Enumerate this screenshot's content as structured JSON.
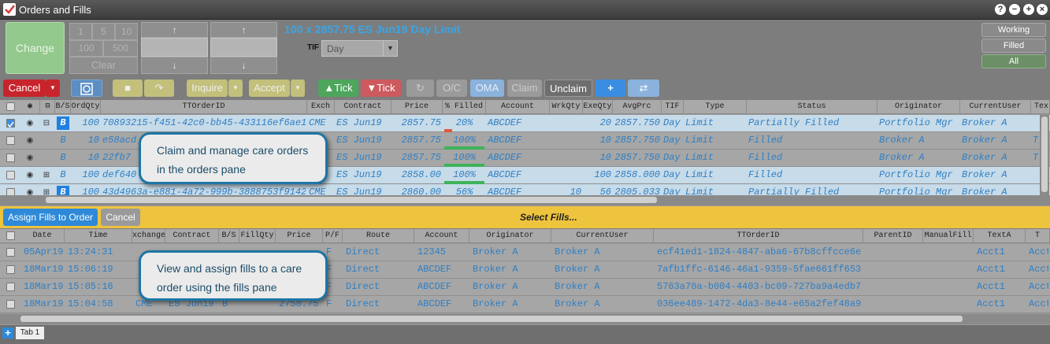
{
  "window": {
    "title": "Orders and Fills",
    "controls": [
      "?",
      "−",
      "+",
      "×"
    ]
  },
  "entry": {
    "change_label": "Change",
    "qty_buttons": [
      "1",
      "5",
      "10",
      "100",
      "500"
    ],
    "clear_label": "Clear",
    "order_desc": "100 x 2857.75 ES Jun19 Day Limit",
    "tif_label": "TIF",
    "tif_value": "Day"
  },
  "filters": {
    "working": "Working",
    "filled": "Filled",
    "all": "All"
  },
  "toolbar": {
    "cancel": "Cancel",
    "inquire": "Inquire",
    "accept": "Accept",
    "tick_up": "Tick",
    "tick_down": "Tick",
    "oc": "O/C",
    "oma": "OMA",
    "claim": "Claim",
    "unclaim": "Unclaim"
  },
  "orders": {
    "columns": [
      "B/S",
      "OrdQty",
      "TTOrderID",
      "Exch",
      "Contract",
      "Price",
      "% Filled",
      "Account",
      "WrkQty",
      "ExeQty",
      "AvgPrc",
      "TIF",
      "Type",
      "Status",
      "Originator",
      "CurrentUser",
      "Tex"
    ],
    "rows": [
      {
        "bs": "B",
        "qty": "100",
        "id": "70893215-f451-42c0-bb45-433116ef6ae1",
        "exch": "CME",
        "contract": "ES Jun19",
        "price": "2857.75",
        "pct": "20%",
        "account": "ABCDEF",
        "wrk": "",
        "exe": "20",
        "avg": "2857.750",
        "tif": "Day",
        "type": "Limit",
        "status": "Partially Filled",
        "orig": "Portfolio Mgr",
        "cur": "Broker  A",
        "tex": ""
      },
      {
        "bs": "B",
        "qty": "10",
        "id": "e58acd",
        "exch": "",
        "contract": "ES Jun19",
        "price": "2857.75",
        "pct": "100%",
        "account": "ABCDEF",
        "wrk": "",
        "exe": "10",
        "avg": "2857.750",
        "tif": "Day",
        "type": "Limit",
        "status": "Filled",
        "orig": "Broker  A",
        "cur": "Broker  A",
        "tex": "T"
      },
      {
        "bs": "B",
        "qty": "10",
        "id": "22fb7",
        "exch": "",
        "contract": "ES Jun19",
        "price": "2857.75",
        "pct": "100%",
        "account": "ABCDEF",
        "wrk": "",
        "exe": "10",
        "avg": "2857.750",
        "tif": "Day",
        "type": "Limit",
        "status": "Filled",
        "orig": "Broker  A",
        "cur": "Broker  A",
        "tex": "T"
      },
      {
        "bs": "B",
        "qty": "100",
        "id": "def640",
        "exch": "",
        "contract": "ES Jun19",
        "price": "2858.00",
        "pct": "100%",
        "account": "ABCDEF",
        "wrk": "",
        "exe": "100",
        "avg": "2858.000",
        "tif": "Day",
        "type": "Limit",
        "status": "Filled",
        "orig": "Portfolio Mgr",
        "cur": "Broker  A",
        "tex": ""
      },
      {
        "bs": "B",
        "qty": "100",
        "id": "43d4963a-e881-4a72-999b-3888753f9142",
        "exch": "CME",
        "contract": "ES Jun19",
        "price": "2860.00",
        "pct": "56%",
        "account": "ABCDEF",
        "wrk": "10",
        "exe": "56",
        "avg": "2805.033",
        "tif": "Day",
        "type": "Limit",
        "status": "Partially Filled",
        "orig": "Portfolio Mgr",
        "cur": "Broker  A",
        "tex": ""
      }
    ]
  },
  "assign": {
    "assign_label": "Assign Fills to Order",
    "cancel_label": "Cancel",
    "select_label": "Select Fills..."
  },
  "fills": {
    "columns": [
      "Date",
      "Time",
      "xchange",
      "Contract",
      "B/S",
      "FillQty",
      "Price",
      "P/F",
      "Route",
      "Account",
      "Originator",
      "CurrentUser",
      "TTOrderID",
      "ParentID",
      "ManualFill",
      "TextA",
      "T"
    ],
    "rows": [
      {
        "date": "05Apr19",
        "time": "13:24:31",
        "route": "Direct",
        "account": "12345",
        "orig": "Broker  A",
        "cur": "Broker  A",
        "id": "ecf41ed1-1824-4847-aba6-67b8cffcce6e",
        "text": "Acct1",
        "t": "Acct"
      },
      {
        "date": "18Mar19",
        "time": "15:06:19",
        "route": "Direct",
        "account": "ABCDEF",
        "orig": "Broker  A",
        "cur": "Broker  A",
        "id": "7afb1ffc-6146-46a1-9359-5fae661ff653",
        "text": "Acct1",
        "t": "Acct"
      },
      {
        "date": "18Mar19",
        "time": "15:05:16",
        "route": "Direct",
        "account": "ABCDEF",
        "orig": "Broker  A",
        "cur": "Broker  A",
        "id": "5763a70a-b004-4403-bc09-727ba9a4edb7",
        "text": "Acct1",
        "t": "Acct"
      },
      {
        "date": "18Mar19",
        "time": "15:04:58",
        "route": "Direct",
        "account": "ABCDEF",
        "orig": "Broker  A",
        "cur": "Broker  A",
        "id": "036ee489-1472-4da3-8e44-e65a2fef48a9",
        "text": "Acct1",
        "t": "Acct",
        "xch": "CME",
        "contract": "ES Jun19",
        "bs": "B",
        "price": "2758.75"
      }
    ]
  },
  "callouts": {
    "orders": "Claim and manage care orders in the orders pane",
    "fills": "View and assign fills to a care order using the fills pane"
  },
  "footer": {
    "tab": "Tab 1"
  }
}
